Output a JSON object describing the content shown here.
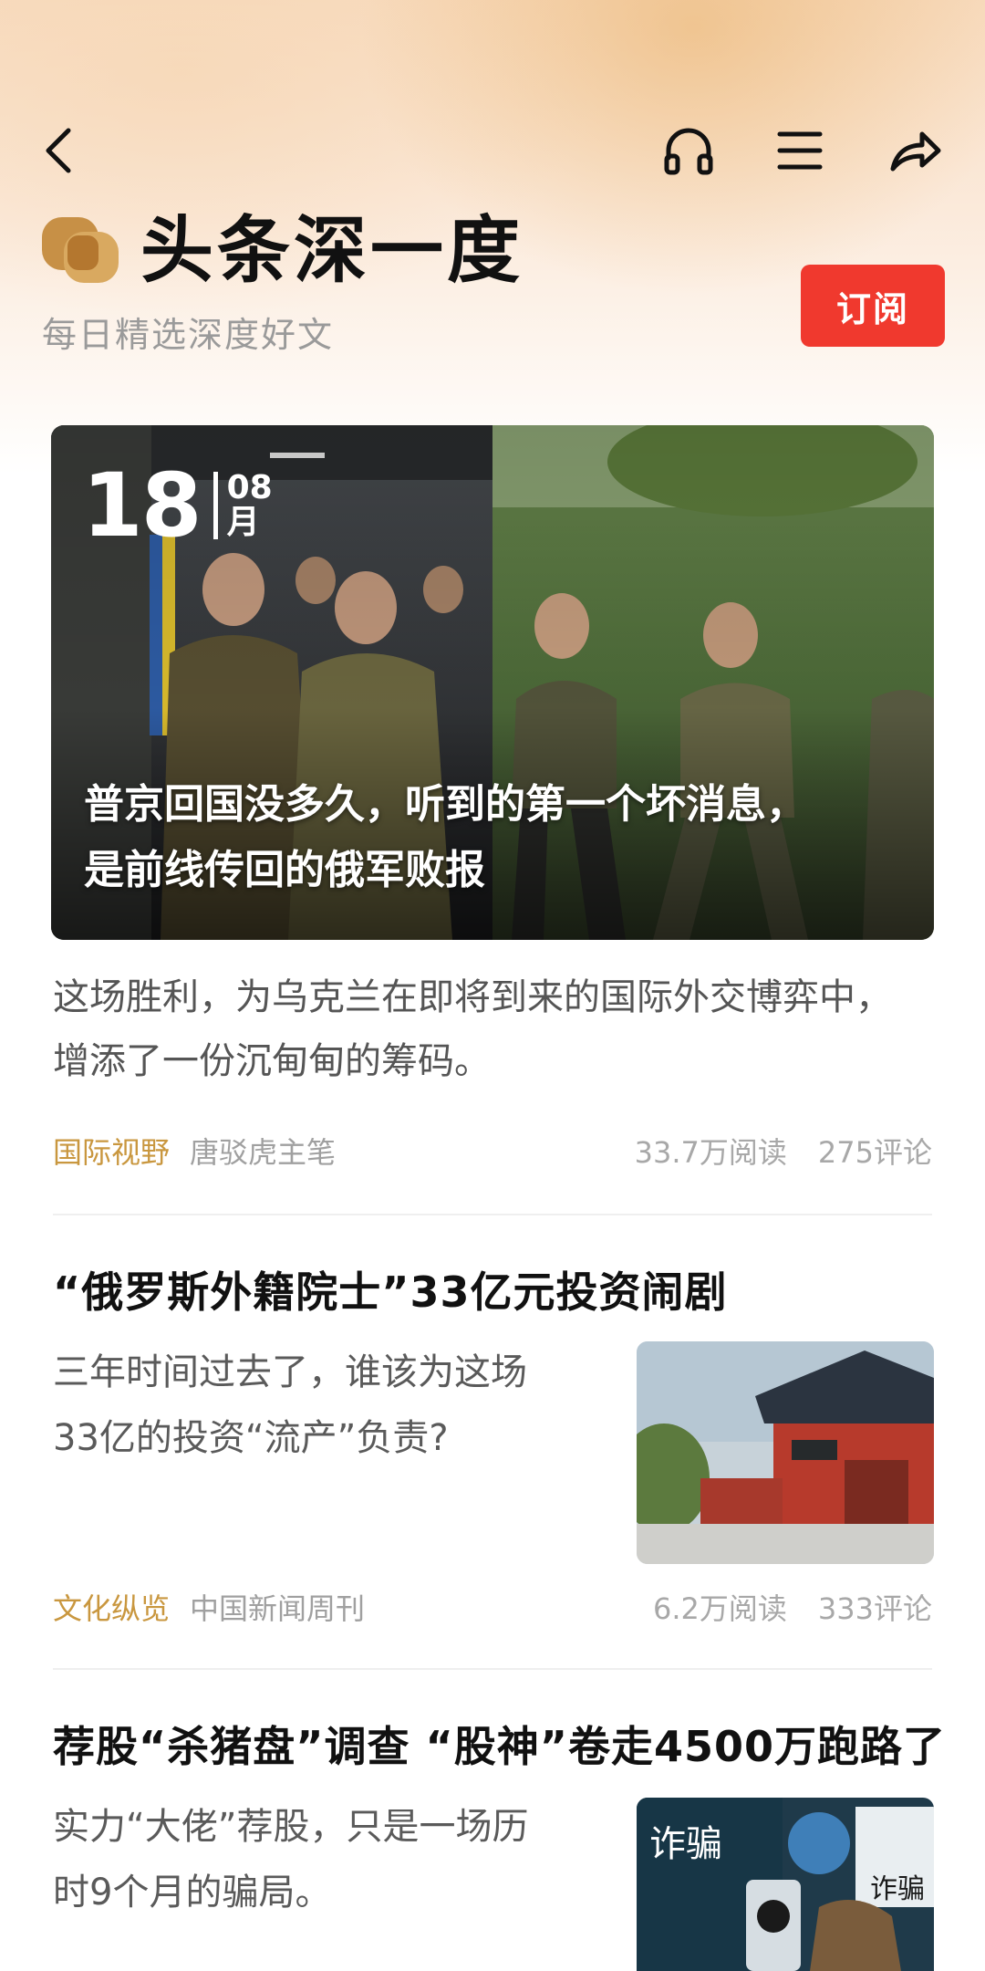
{
  "header": {
    "brand_title": "头条深一度",
    "brand_subtitle": "每日精选深度好文",
    "subscribe_label": "订阅",
    "icons": [
      "back-icon",
      "headphones-icon",
      "menu-icon",
      "share-icon"
    ]
  },
  "feature": {
    "date_day": "18",
    "date_month_num": "08",
    "date_month_char": "月",
    "title_line1": "普京回国没多久，听到的第一个坏消息，",
    "title_line2": "是前线传回的俄军败报",
    "summary_line1": "这场胜利，为乌克兰在即将到来的国际外交博弈中，",
    "summary_line2": "增添了一份沉甸甸的筹码。",
    "category": "国际视野",
    "source": "唐驳虎主笔",
    "reads": "33.7万阅读",
    "comments": "275评论"
  },
  "articles": [
    {
      "title": "“俄罗斯外籍院士”33亿元投资闹剧",
      "summary_line1": "三年时间过去了，谁该为这场",
      "summary_line2": "33亿的投资“流产”负责?",
      "category": "文化纵览",
      "source": "中国新闻周刊",
      "reads": "6.2万阅读",
      "comments": "333评论"
    },
    {
      "title": "荐股“杀猪盘”调查 “股神”卷走4500万跑路了",
      "summary_line1": "实力“大佬”荐股，只是一场历",
      "summary_line2": "时9个月的骗局。",
      "thumb_text_1": "诈骗",
      "thumb_text_2": "诈骗"
    }
  ],
  "colors": {
    "accent_gold": "#c9973f",
    "subscribe_red": "#f0392e"
  }
}
